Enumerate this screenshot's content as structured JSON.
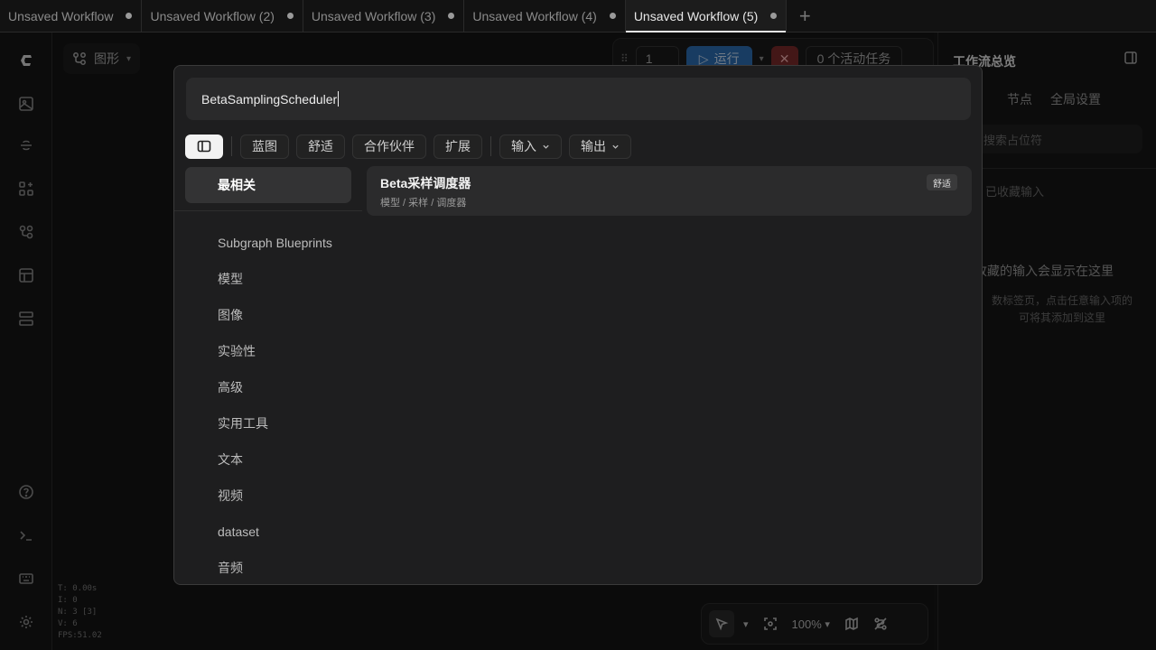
{
  "tabs": [
    {
      "label": "Unsaved Workflow"
    },
    {
      "label": "Unsaved Workflow (2)"
    },
    {
      "label": "Unsaved Workflow (3)"
    },
    {
      "label": "Unsaved Workflow (4)"
    },
    {
      "label": "Unsaved Workflow (5)"
    }
  ],
  "toolbar": {
    "graph_label": "图形",
    "queue_count": "1",
    "run_label": "运行",
    "active_tasks": "0 个活动任务"
  },
  "stats": {
    "t": "T: 0.00s",
    "i": "I: 0",
    "n": "N: 3 [3]",
    "v": "V: 6",
    "fps": "FPS:51.02"
  },
  "bottombar": {
    "zoom": "100%"
  },
  "right_panel": {
    "title": "工作流总览",
    "tab_nodes": "节点",
    "tab_global": "全局设置",
    "search_placeholder": "搜索占位符",
    "favorites_label": "已收藏输入",
    "empty_title": "收藏的输入会显示在这里",
    "empty_hint_1": "数标签页，点击任意输入项的",
    "empty_hint_2": "可将其添加到这里"
  },
  "dialog": {
    "search_value": "BetaSamplingScheduler",
    "filters": {
      "blueprint": "蓝图",
      "comfy": "舒适",
      "partner": "合作伙伴",
      "extension": "扩展",
      "input": "输入",
      "output": "输出"
    },
    "selected_category": "最相关",
    "categories": [
      "Subgraph Blueprints",
      "模型",
      "图像",
      "实验性",
      "高级",
      "实用工具",
      "文本",
      "视频",
      "dataset",
      "音频"
    ],
    "result": {
      "name": "Beta采样调度器",
      "path": "模型 / 采样 / 调度器",
      "badge": "舒适"
    }
  },
  "colors": {
    "run_button": "#2d6db3",
    "stop_button": "#7a2a2a",
    "dialog_bg": "#1e1e1f"
  }
}
